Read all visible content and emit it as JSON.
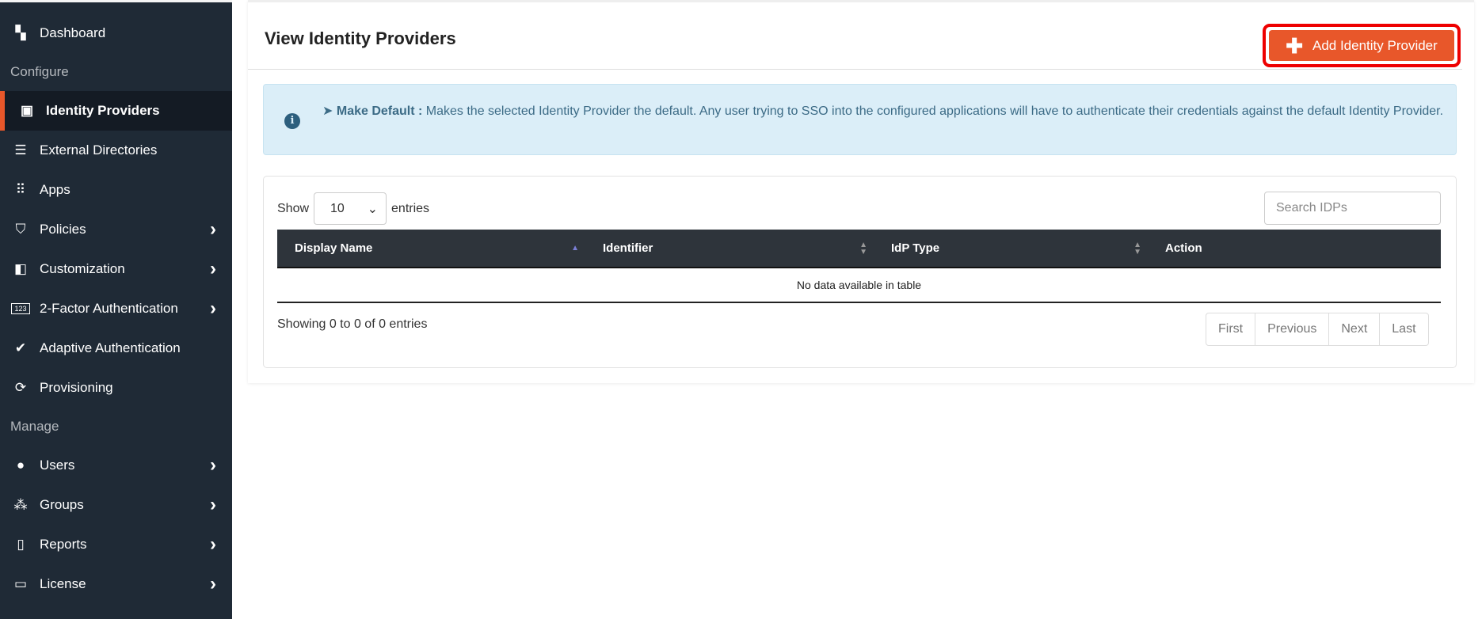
{
  "sidebar": {
    "items": [
      {
        "type": "item",
        "label": "Dashboard",
        "icon": "dashboard-icon",
        "glyph": "▚"
      },
      {
        "type": "section",
        "label": "Configure"
      },
      {
        "type": "item",
        "label": "Identity Providers",
        "icon": "id-badge-icon",
        "glyph": "▣",
        "active": true
      },
      {
        "type": "item",
        "label": "External Directories",
        "icon": "server-icon",
        "glyph": "☰"
      },
      {
        "type": "item",
        "label": "Apps",
        "icon": "grid-icon",
        "glyph": "⠿"
      },
      {
        "type": "item",
        "label": "Policies",
        "icon": "shield-search-icon",
        "glyph": "⛉",
        "chevron": true
      },
      {
        "type": "item",
        "label": "Customization",
        "icon": "shapes-icon",
        "glyph": "◧",
        "chevron": true
      },
      {
        "type": "item",
        "label": "2-Factor Authentication",
        "icon": "123-icon",
        "glyph": "123",
        "chevron": true
      },
      {
        "type": "item",
        "label": "Adaptive Authentication",
        "icon": "shield-check-icon",
        "glyph": "✔"
      },
      {
        "type": "item",
        "label": "Provisioning",
        "icon": "sync-icon",
        "glyph": "⟳"
      },
      {
        "type": "section",
        "label": "Manage"
      },
      {
        "type": "item",
        "label": "Users",
        "icon": "user-icon",
        "glyph": "●",
        "chevron": true
      },
      {
        "type": "item",
        "label": "Groups",
        "icon": "users-icon",
        "glyph": "⁂",
        "chevron": true
      },
      {
        "type": "item",
        "label": "Reports",
        "icon": "clipboard-icon",
        "glyph": "▯",
        "chevron": true
      },
      {
        "type": "item",
        "label": "License",
        "icon": "credit-card-icon",
        "glyph": "▭",
        "chevron": true
      }
    ]
  },
  "header": {
    "title": "View Identity Providers",
    "add_button": "Add Identity Provider"
  },
  "info": {
    "label": "Make Default :",
    "text": " Makes the selected Identity Provider the default. Any user trying to SSO into the configured applications will have to authenticate their credentials against the default Identity Provider."
  },
  "table": {
    "show_label": "Show",
    "entries_label": "entries",
    "page_size": "10",
    "search_placeholder": "Search IDPs",
    "columns": [
      "Display Name",
      "Identifier",
      "IdP Type",
      "Action"
    ],
    "empty_text": "No data available in table",
    "showing_text": "Showing 0 to 0 of 0 entries",
    "pagination": [
      "First",
      "Previous",
      "Next",
      "Last"
    ]
  },
  "colors": {
    "sidebar": "#1f2a36",
    "accent": "#e8572a",
    "highlight": "#ee0000",
    "info_bg": "#dbeef8",
    "table_header": "#2e343b"
  }
}
